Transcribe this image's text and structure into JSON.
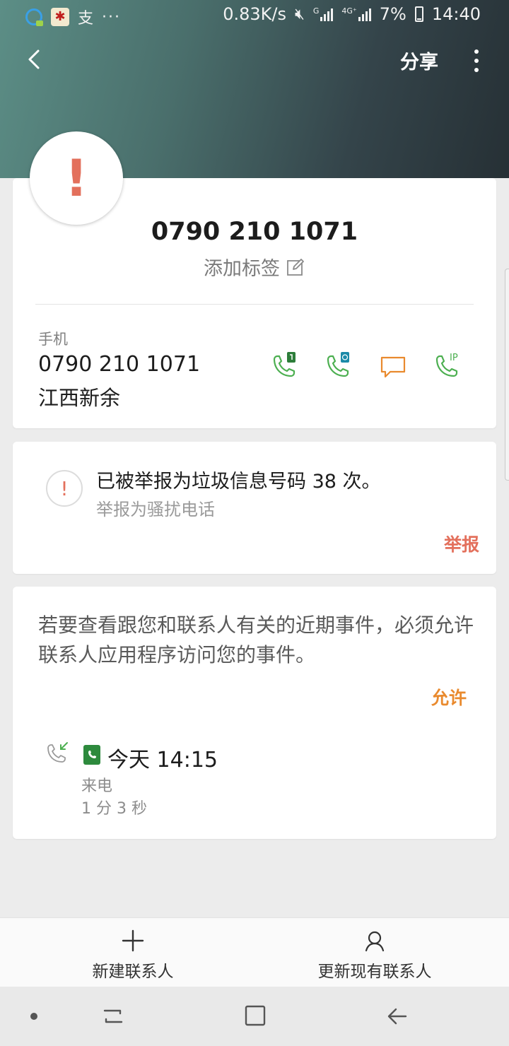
{
  "status_bar": {
    "app_char": "支",
    "more": "···",
    "speed": "0.83K/s",
    "net1": "G",
    "net2": "4G⁺",
    "battery": "7%",
    "time": "14:40"
  },
  "top_bar": {
    "share": "分享"
  },
  "contact": {
    "avatar_glyph": "!",
    "number": "0790 210 1071",
    "add_tag": "添加标签",
    "phone_type": "手机",
    "phone": "0790 210 1071",
    "region": "江西新余",
    "ip_label": "IP"
  },
  "spam": {
    "icon_glyph": "!",
    "title": "已被举报为垃圾信息号码 38 次。",
    "subtitle": "举报为骚扰电话",
    "report": "举报"
  },
  "events": {
    "message": "若要查看跟您和联系人有关的近期事件，必须允许联系人应用程序访问您的事件。",
    "allow": "允许",
    "call_time": "今天 14:15",
    "call_type": "来电",
    "call_duration": "1 分 3 秒"
  },
  "bottom_actions": {
    "new_contact": "新建联系人",
    "update_contact": "更新现有联系人"
  },
  "colors": {
    "accent_red": "#e3705c",
    "accent_orange": "#e98a2e",
    "call_green": "#4caf50"
  }
}
